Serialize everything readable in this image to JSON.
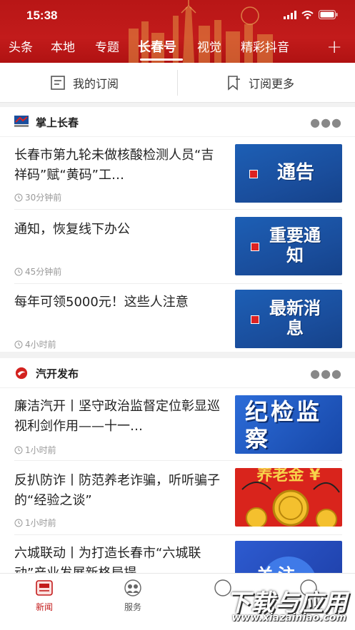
{
  "status_bar": {
    "time": "15:38"
  },
  "top_tabs": [
    {
      "label": "头条"
    },
    {
      "label": "本地"
    },
    {
      "label": "专题"
    },
    {
      "label": "长春号"
    },
    {
      "label": "视觉"
    },
    {
      "label": "精彩抖音"
    }
  ],
  "active_tab": "长春号",
  "add_label": "+",
  "subscribe": {
    "mine": "我的订阅",
    "more": "订阅更多"
  },
  "sections": [
    {
      "source": "掌上长春",
      "news": [
        {
          "title": "长春市第九轮未做核酸检测人员“吉祥码”赋“黄码”工…",
          "time": "30分钟前",
          "thumb_text": "通告"
        },
        {
          "title": "通知，恢复线下办公",
          "time": "45分钟前",
          "thumb_text": "重要通知"
        },
        {
          "title": "每年可领5000元！这些人注意",
          "time": "4小时前",
          "thumb_text": "最新消息"
        }
      ]
    },
    {
      "source": "汽开发布",
      "news": [
        {
          "title": "廉洁汽开丨坚守政治监督定位彰显巡视利剑作用——十一…",
          "time": "1小时前",
          "thumb_text": "纪检监察"
        },
        {
          "title": "反扒防诈丨防范养老诈骗，听听骗子的“经验之谈”",
          "time": "1小时前",
          "thumb_text": "养老金 ¥"
        },
        {
          "title": "六城联动丨为打造长春市“六城联动”产业发展新格局提…",
          "time": "",
          "thumb_text": "关注"
        }
      ]
    }
  ],
  "bottom_nav": [
    {
      "label": "新闻",
      "active": true
    },
    {
      "label": "服务",
      "active": false
    }
  ],
  "watermark": {
    "line1": "下载与应用",
    "line2": "www.xiazainiao.com"
  },
  "colors": {
    "brand_red": "#c21b1b",
    "thumb_blue": "#1a4e9d"
  }
}
